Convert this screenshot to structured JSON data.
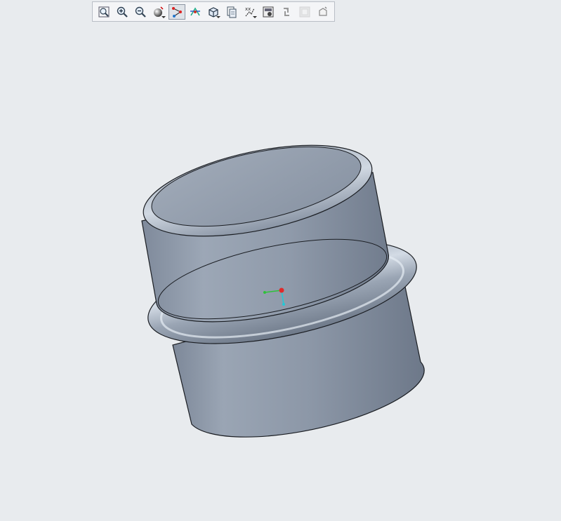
{
  "toolbar": {
    "buttons": [
      {
        "icon": "refit-icon",
        "state": "normal"
      },
      {
        "icon": "zoom-in-icon",
        "state": "normal"
      },
      {
        "icon": "zoom-out-icon",
        "state": "normal"
      },
      {
        "icon": "display-style-icon",
        "state": "normal",
        "dropdown": true
      },
      {
        "icon": "datum-display-icon",
        "state": "active"
      },
      {
        "icon": "spin-center-icon",
        "state": "normal"
      },
      {
        "icon": "saved-views-icon",
        "state": "normal",
        "dropdown": true
      },
      {
        "icon": "view-manager-icon",
        "state": "normal"
      },
      {
        "icon": "annotation-display-icon",
        "state": "normal",
        "dropdown": true
      },
      {
        "icon": "appearance-gallery-icon",
        "state": "normal"
      },
      {
        "icon": "regenerate-icon",
        "state": "normal"
      },
      {
        "icon": "section-icon",
        "state": "disabled"
      },
      {
        "icon": "repaint-icon",
        "state": "normal"
      }
    ]
  },
  "viewport": {
    "background": "#e8ebee",
    "model_color": "#8b96a6",
    "model_highlight": "#b8c2cf",
    "edge_color": "#1a1d22",
    "csys_axes": [
      "x-axis-red",
      "y-axis-green",
      "z-axis-cyan"
    ]
  }
}
